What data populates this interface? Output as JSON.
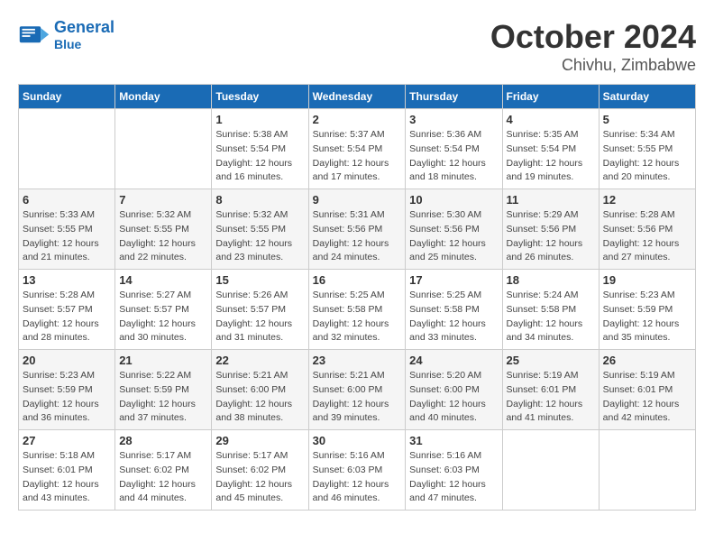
{
  "header": {
    "logo_name": "General",
    "logo_sub": "Blue",
    "month": "October 2024",
    "location": "Chivhu, Zimbabwe"
  },
  "weekdays": [
    "Sunday",
    "Monday",
    "Tuesday",
    "Wednesday",
    "Thursday",
    "Friday",
    "Saturday"
  ],
  "weeks": [
    [
      {
        "day": "",
        "sunrise": "",
        "sunset": "",
        "daylight": ""
      },
      {
        "day": "",
        "sunrise": "",
        "sunset": "",
        "daylight": ""
      },
      {
        "day": "1",
        "sunrise": "Sunrise: 5:38 AM",
        "sunset": "Sunset: 5:54 PM",
        "daylight": "Daylight: 12 hours and 16 minutes."
      },
      {
        "day": "2",
        "sunrise": "Sunrise: 5:37 AM",
        "sunset": "Sunset: 5:54 PM",
        "daylight": "Daylight: 12 hours and 17 minutes."
      },
      {
        "day": "3",
        "sunrise": "Sunrise: 5:36 AM",
        "sunset": "Sunset: 5:54 PM",
        "daylight": "Daylight: 12 hours and 18 minutes."
      },
      {
        "day": "4",
        "sunrise": "Sunrise: 5:35 AM",
        "sunset": "Sunset: 5:54 PM",
        "daylight": "Daylight: 12 hours and 19 minutes."
      },
      {
        "day": "5",
        "sunrise": "Sunrise: 5:34 AM",
        "sunset": "Sunset: 5:55 PM",
        "daylight": "Daylight: 12 hours and 20 minutes."
      }
    ],
    [
      {
        "day": "6",
        "sunrise": "Sunrise: 5:33 AM",
        "sunset": "Sunset: 5:55 PM",
        "daylight": "Daylight: 12 hours and 21 minutes."
      },
      {
        "day": "7",
        "sunrise": "Sunrise: 5:32 AM",
        "sunset": "Sunset: 5:55 PM",
        "daylight": "Daylight: 12 hours and 22 minutes."
      },
      {
        "day": "8",
        "sunrise": "Sunrise: 5:32 AM",
        "sunset": "Sunset: 5:55 PM",
        "daylight": "Daylight: 12 hours and 23 minutes."
      },
      {
        "day": "9",
        "sunrise": "Sunrise: 5:31 AM",
        "sunset": "Sunset: 5:56 PM",
        "daylight": "Daylight: 12 hours and 24 minutes."
      },
      {
        "day": "10",
        "sunrise": "Sunrise: 5:30 AM",
        "sunset": "Sunset: 5:56 PM",
        "daylight": "Daylight: 12 hours and 25 minutes."
      },
      {
        "day": "11",
        "sunrise": "Sunrise: 5:29 AM",
        "sunset": "Sunset: 5:56 PM",
        "daylight": "Daylight: 12 hours and 26 minutes."
      },
      {
        "day": "12",
        "sunrise": "Sunrise: 5:28 AM",
        "sunset": "Sunset: 5:56 PM",
        "daylight": "Daylight: 12 hours and 27 minutes."
      }
    ],
    [
      {
        "day": "13",
        "sunrise": "Sunrise: 5:28 AM",
        "sunset": "Sunset: 5:57 PM",
        "daylight": "Daylight: 12 hours and 28 minutes."
      },
      {
        "day": "14",
        "sunrise": "Sunrise: 5:27 AM",
        "sunset": "Sunset: 5:57 PM",
        "daylight": "Daylight: 12 hours and 30 minutes."
      },
      {
        "day": "15",
        "sunrise": "Sunrise: 5:26 AM",
        "sunset": "Sunset: 5:57 PM",
        "daylight": "Daylight: 12 hours and 31 minutes."
      },
      {
        "day": "16",
        "sunrise": "Sunrise: 5:25 AM",
        "sunset": "Sunset: 5:58 PM",
        "daylight": "Daylight: 12 hours and 32 minutes."
      },
      {
        "day": "17",
        "sunrise": "Sunrise: 5:25 AM",
        "sunset": "Sunset: 5:58 PM",
        "daylight": "Daylight: 12 hours and 33 minutes."
      },
      {
        "day": "18",
        "sunrise": "Sunrise: 5:24 AM",
        "sunset": "Sunset: 5:58 PM",
        "daylight": "Daylight: 12 hours and 34 minutes."
      },
      {
        "day": "19",
        "sunrise": "Sunrise: 5:23 AM",
        "sunset": "Sunset: 5:59 PM",
        "daylight": "Daylight: 12 hours and 35 minutes."
      }
    ],
    [
      {
        "day": "20",
        "sunrise": "Sunrise: 5:23 AM",
        "sunset": "Sunset: 5:59 PM",
        "daylight": "Daylight: 12 hours and 36 minutes."
      },
      {
        "day": "21",
        "sunrise": "Sunrise: 5:22 AM",
        "sunset": "Sunset: 5:59 PM",
        "daylight": "Daylight: 12 hours and 37 minutes."
      },
      {
        "day": "22",
        "sunrise": "Sunrise: 5:21 AM",
        "sunset": "Sunset: 6:00 PM",
        "daylight": "Daylight: 12 hours and 38 minutes."
      },
      {
        "day": "23",
        "sunrise": "Sunrise: 5:21 AM",
        "sunset": "Sunset: 6:00 PM",
        "daylight": "Daylight: 12 hours and 39 minutes."
      },
      {
        "day": "24",
        "sunrise": "Sunrise: 5:20 AM",
        "sunset": "Sunset: 6:00 PM",
        "daylight": "Daylight: 12 hours and 40 minutes."
      },
      {
        "day": "25",
        "sunrise": "Sunrise: 5:19 AM",
        "sunset": "Sunset: 6:01 PM",
        "daylight": "Daylight: 12 hours and 41 minutes."
      },
      {
        "day": "26",
        "sunrise": "Sunrise: 5:19 AM",
        "sunset": "Sunset: 6:01 PM",
        "daylight": "Daylight: 12 hours and 42 minutes."
      }
    ],
    [
      {
        "day": "27",
        "sunrise": "Sunrise: 5:18 AM",
        "sunset": "Sunset: 6:01 PM",
        "daylight": "Daylight: 12 hours and 43 minutes."
      },
      {
        "day": "28",
        "sunrise": "Sunrise: 5:17 AM",
        "sunset": "Sunset: 6:02 PM",
        "daylight": "Daylight: 12 hours and 44 minutes."
      },
      {
        "day": "29",
        "sunrise": "Sunrise: 5:17 AM",
        "sunset": "Sunset: 6:02 PM",
        "daylight": "Daylight: 12 hours and 45 minutes."
      },
      {
        "day": "30",
        "sunrise": "Sunrise: 5:16 AM",
        "sunset": "Sunset: 6:03 PM",
        "daylight": "Daylight: 12 hours and 46 minutes."
      },
      {
        "day": "31",
        "sunrise": "Sunrise: 5:16 AM",
        "sunset": "Sunset: 6:03 PM",
        "daylight": "Daylight: 12 hours and 47 minutes."
      },
      {
        "day": "",
        "sunrise": "",
        "sunset": "",
        "daylight": ""
      },
      {
        "day": "",
        "sunrise": "",
        "sunset": "",
        "daylight": ""
      }
    ]
  ]
}
